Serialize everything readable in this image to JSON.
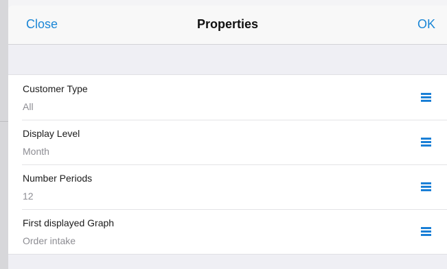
{
  "nav": {
    "close_label": "Close",
    "title": "Properties",
    "ok_label": "OK"
  },
  "properties": [
    {
      "label": "Customer Type",
      "value": "All",
      "icon": "list-menu-icon"
    },
    {
      "label": "Display Level",
      "value": "Month",
      "icon": "list-menu-icon"
    },
    {
      "label": "Number Periods",
      "value": "12",
      "icon": "list-menu-icon"
    },
    {
      "label": "First displayed Graph",
      "value": "Order intake",
      "icon": "list-menu-icon"
    }
  ],
  "colors": {
    "accent": "#1a86d6",
    "icon": "#1a7fd6",
    "background": "#efeff4"
  }
}
